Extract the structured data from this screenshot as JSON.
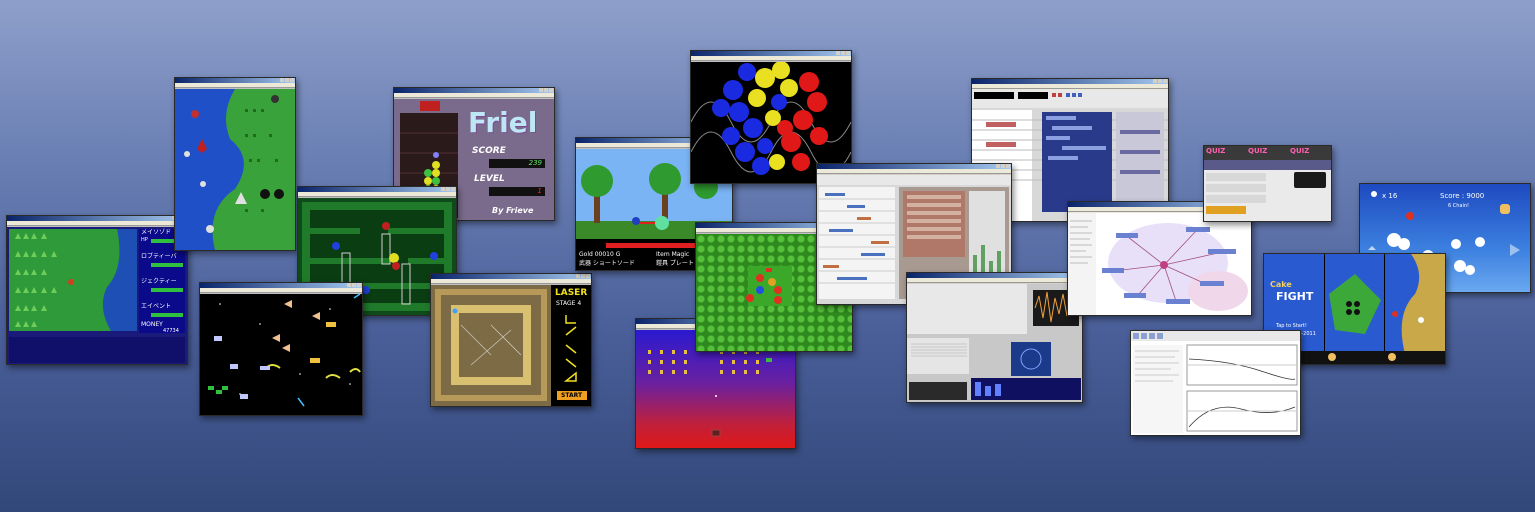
{
  "friel": {
    "title": "Friel",
    "score_label": "SCORE",
    "score_value": "239",
    "level_label": "LEVEL",
    "level_value": "1",
    "credit": "By Frieve"
  },
  "laser": {
    "title": "LASER",
    "stage": "STAGE 4",
    "start": "START"
  },
  "rpg": {
    "char1": "メイソゾド",
    "char2": "ロブティーバ",
    "char3": "ジェクティー",
    "char4": "エイベント",
    "hp": "HP",
    "money_label": "MONEY",
    "money_value": "47734"
  },
  "side_scroller": {
    "gold": "Gold 00010 G",
    "item": "Item Magic",
    "weapon": "武器 ショートソード",
    "armor": "鎧具 プレート"
  },
  "quiz": {
    "q1": "QUIZ",
    "q2": "QUIZ",
    "q3": "QUIZ"
  },
  "mobile_shooter": {
    "lives": "x 16",
    "score": "Score : 9000",
    "combo": "6 Chain!"
  },
  "cake_fight": {
    "title_top": "Cake",
    "title": "FIGHT",
    "tap": "Tap to Start!",
    "copyright": "Frieve 1996-2011"
  },
  "colors": {
    "bg_top": "#8e9fca",
    "bg_bottom": "#324779",
    "titlebar": "#0a246a"
  }
}
